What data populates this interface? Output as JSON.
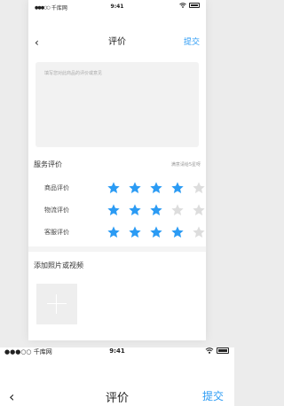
{
  "status_bar": {
    "carrier": "千库网",
    "time": "9:41"
  },
  "nav": {
    "back": "‹",
    "title": "评价",
    "submit": "提交"
  },
  "review": {
    "placeholder": "填写您对此商品的评价或意见"
  },
  "service": {
    "title": "服务评价",
    "hint": "满意请给5星呀",
    "ratings": [
      {
        "label": "商品评价",
        "stars": 4,
        "max": 5
      },
      {
        "label": "物流评价",
        "stars": 3,
        "max": 5
      },
      {
        "label": "客服评价",
        "stars": 4,
        "max": 5
      }
    ]
  },
  "photos": {
    "title": "添加照片或视频"
  },
  "colors": {
    "accent": "#2b9bf4",
    "star_on": "#2b9bf4",
    "star_off": "#dddddd"
  },
  "icons": [
    "signal-dots-icon",
    "wifi-icon",
    "battery-icon",
    "back-chevron-icon",
    "star-icon",
    "plus-icon"
  ]
}
